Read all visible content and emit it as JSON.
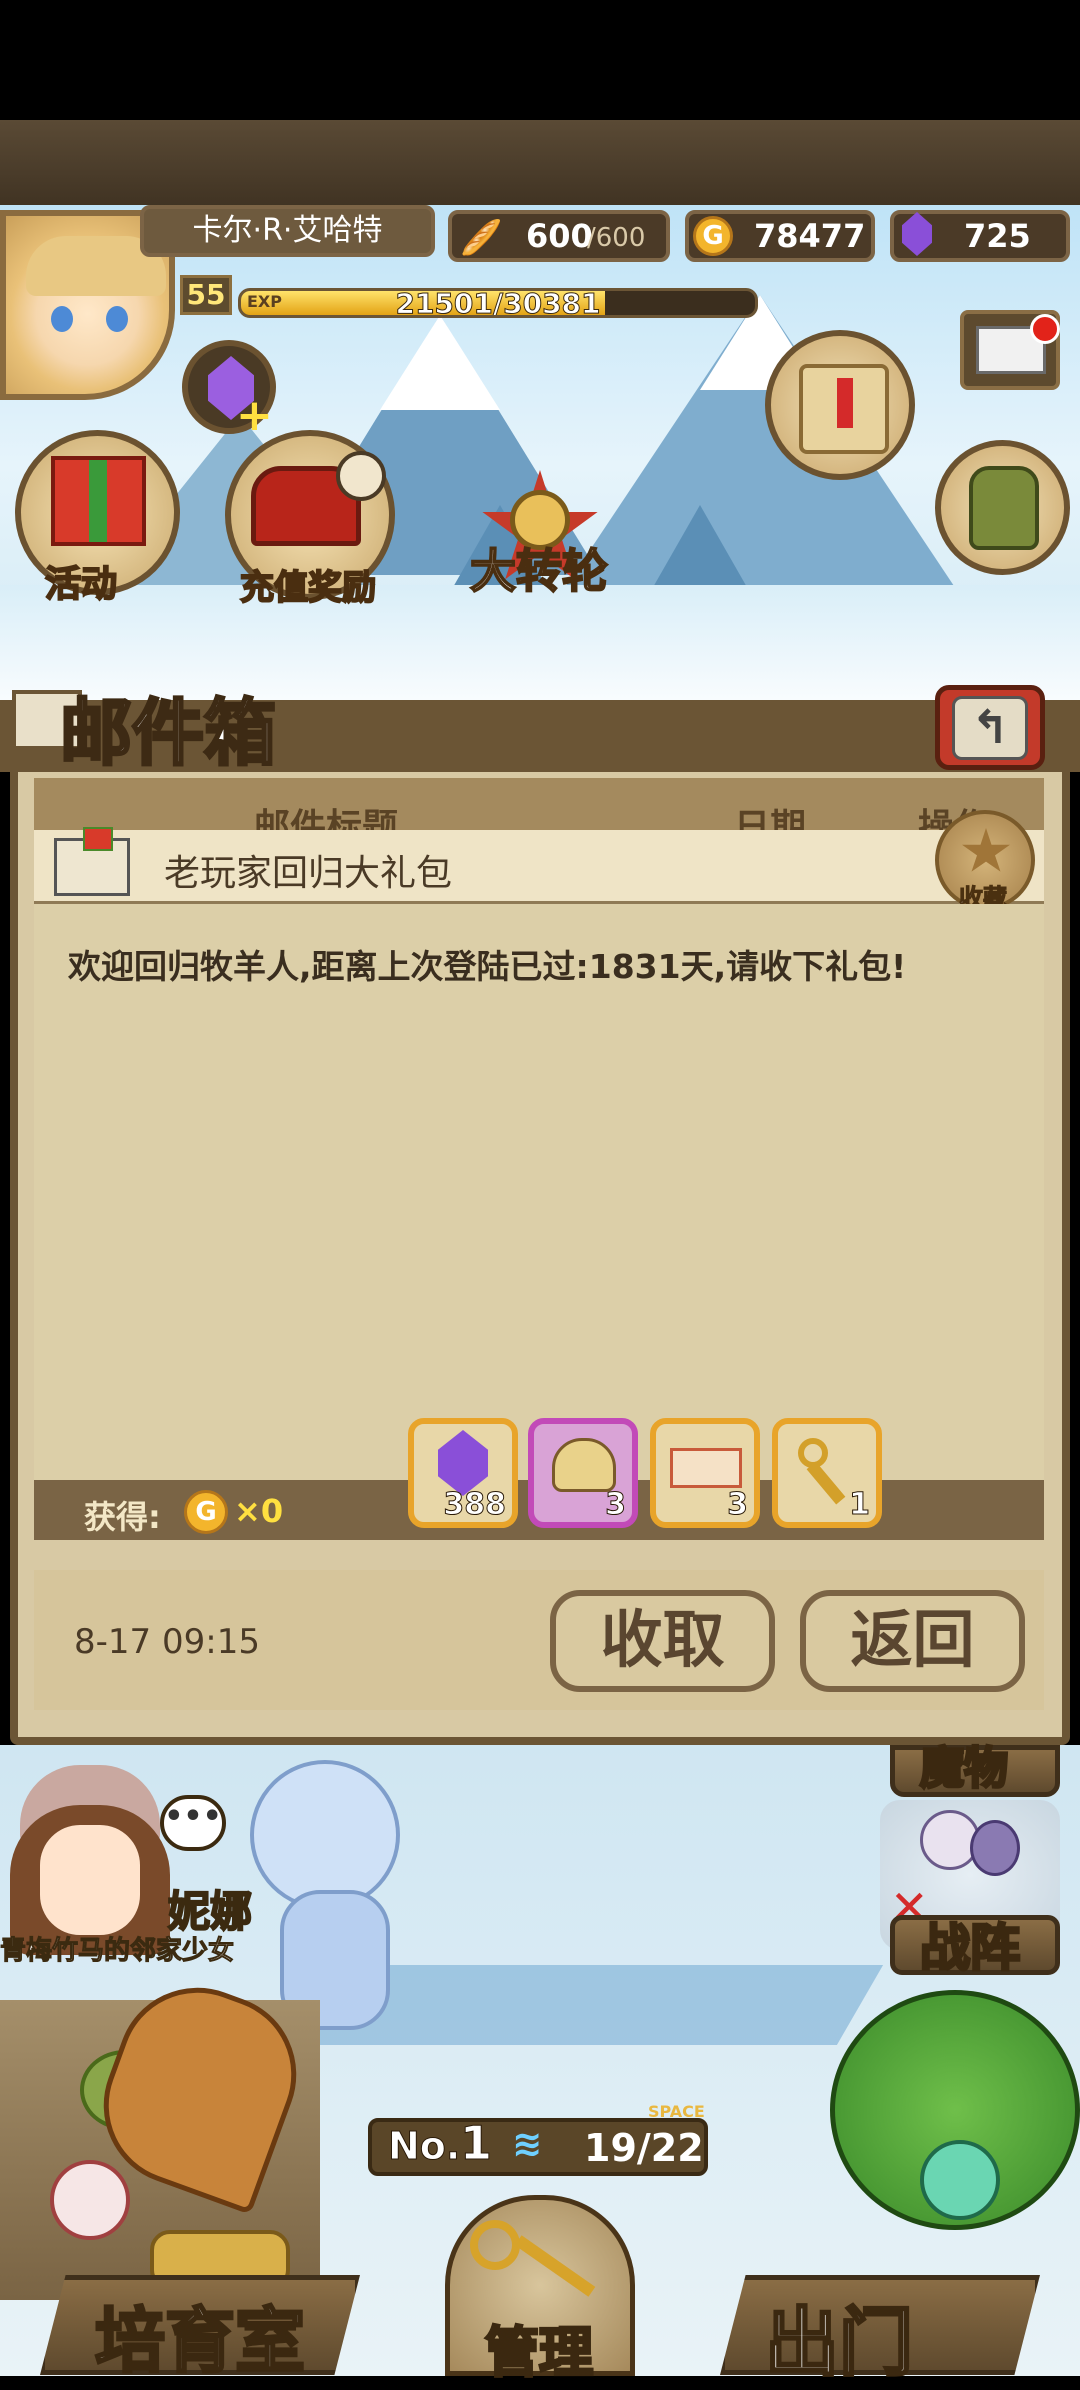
{
  "player": {
    "name": "卡尔·R·艾哈特",
    "level": "55",
    "exp_label": "EXP",
    "exp_text": "21501/30381",
    "exp_fraction": 0.708
  },
  "resources": {
    "stamina_current": "600",
    "stamina_max": "/600",
    "gold": "78477",
    "gems": "725"
  },
  "menu": {
    "event_label": "活动",
    "recharge_label": "充值奖励",
    "wheel_label": "大转轮"
  },
  "mailbox": {
    "title": "邮件箱",
    "columns": [
      "邮件标题",
      "日期",
      "操作"
    ],
    "subject": "老玩家回归大礼包",
    "favorite_label": "收藏",
    "body": "欢迎回归牧羊人,距离上次登陆已过:1831天,请收下礼包!",
    "reward_label": "获得:",
    "gold_reward": "×0",
    "rewards": [
      {
        "icon": "purple-gem-icon",
        "qty": "388"
      },
      {
        "icon": "treasure-bag-icon",
        "qty": "3"
      },
      {
        "icon": "ticket-icon",
        "qty": "3"
      },
      {
        "icon": "golden-key-icon",
        "qty": "1"
      }
    ],
    "date": "8-17 09:15",
    "collect_label": "收取",
    "back_label": "返回"
  },
  "bottom": {
    "npc_name": "妮娜",
    "npc_title": "青梅竹马的邻家少女",
    "monster_tab": "魔物",
    "formation_label": "战阵",
    "no_label": "No.",
    "no_value": "1",
    "space_label": "SPACE",
    "capacity": "19/22",
    "nursery_label": "培育室",
    "manage_label": "管理",
    "exit_label": "出门"
  }
}
